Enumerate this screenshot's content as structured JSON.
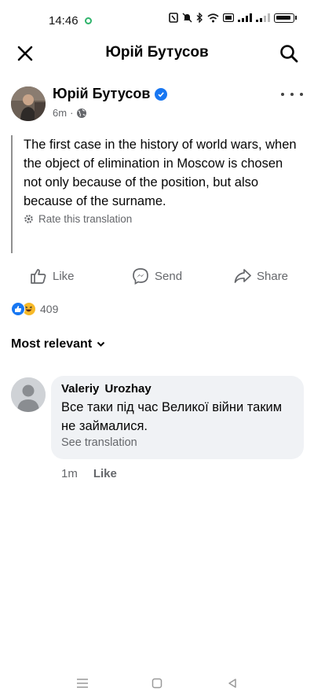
{
  "status_bar": {
    "time": "14:46",
    "icons": [
      "nfc-icon",
      "mute-icon",
      "bluetooth-icon",
      "wifi-icon",
      "signal-icon",
      "signal-icon",
      "battery-icon"
    ]
  },
  "header": {
    "title": "Юрій Бутусов",
    "close_icon": "close-icon",
    "search_icon": "search-icon"
  },
  "post": {
    "author": "Юрій Бутусов",
    "verified": true,
    "time": "6m",
    "audience_icon": "globe-icon",
    "text": "The first case in the history of world wars, when the object of elimination in Moscow is chosen not only because of the position, but also because of the surname.",
    "rate_translation": "Rate this translation"
  },
  "actions": {
    "like": "Like",
    "send": "Send",
    "share": "Share"
  },
  "reactions": {
    "types": [
      "like",
      "haha"
    ],
    "count": "409"
  },
  "comments_sort": "Most relevant",
  "comment": {
    "author": "Valeriy Urozhay",
    "text": "Все таки під час Великої війни таким не займалися.",
    "see_translation": "See translation",
    "time": "1m",
    "like": "Like"
  },
  "colors": {
    "accent": "#1877f2",
    "secondary_text": "#65676b",
    "bubble": "#f0f2f5"
  }
}
